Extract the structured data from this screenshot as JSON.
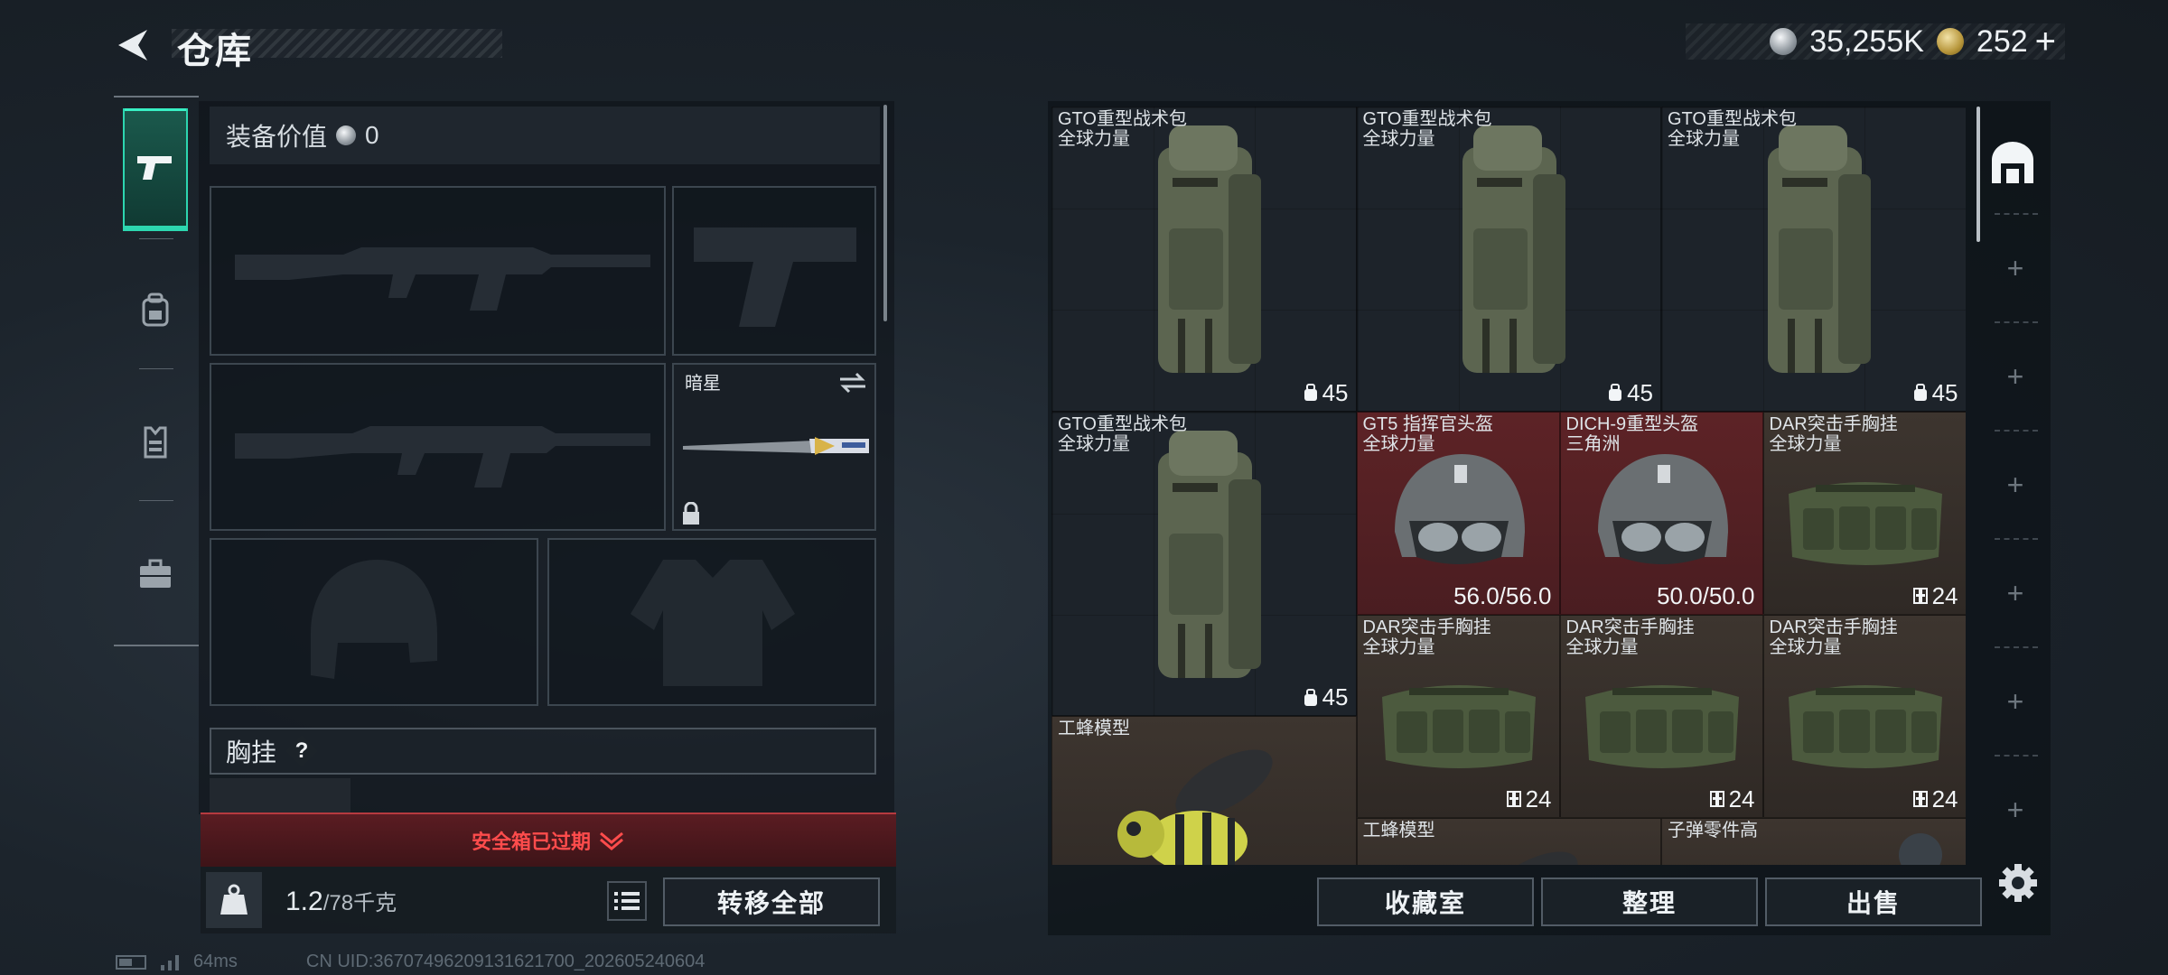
{
  "header": {
    "title": "仓库"
  },
  "currency": {
    "silver": "35,255K",
    "gold": "252",
    "plus": "+"
  },
  "left_tabs": [
    {
      "icon": "pistol-icon"
    },
    {
      "icon": "backpack-icon"
    },
    {
      "icon": "vest-icon"
    },
    {
      "icon": "briefcase-icon"
    }
  ],
  "equipment": {
    "value_label": "装备价值",
    "value": "0",
    "knife_name": "暗星",
    "chest_label": "胸挂",
    "chest_help": "?"
  },
  "safebox": {
    "text": "安全箱已过期"
  },
  "capacity": {
    "current": "1.2",
    "max": "/78千克"
  },
  "buttons": {
    "transfer_all": "转移全部",
    "collection": "收藏室",
    "sort": "整理",
    "sell": "出售"
  },
  "status": {
    "ping": "64ms",
    "uid": "CN UID:3670749620913162170​0_202605240604"
  },
  "inventory": [
    {
      "name": "GTO重型战术包",
      "sub": "全球力量",
      "value": "45",
      "type": "backpack"
    },
    {
      "name": "GTO重型战术包",
      "sub": "全球力量",
      "value": "45",
      "type": "backpack"
    },
    {
      "name": "GTO重型战术包",
      "sub": "全球力量",
      "value": "45",
      "type": "backpack"
    },
    {
      "name": "GTO重型战术包",
      "sub": "全球力量",
      "value": "45",
      "type": "backpack"
    },
    {
      "name": "GT5 指挥官头盔",
      "sub": "全球力量",
      "value": "56.0/56.0",
      "type": "helmet"
    },
    {
      "name": "DICH-9重型头盔",
      "sub": "三角洲",
      "value": "50.0/50.0",
      "type": "helmet"
    },
    {
      "name": "DAR突击手胸挂",
      "sub": "全球力量",
      "value": "24",
      "type": "rig"
    },
    {
      "name": "DAR突击手胸挂",
      "sub": "全球力量",
      "value": "24",
      "type": "rig"
    },
    {
      "name": "DAR突击手胸挂",
      "sub": "全球力量",
      "value": "24",
      "type": "rig"
    },
    {
      "name": "DAR突击手胸挂",
      "sub": "全球力量",
      "value": "24",
      "type": "rig"
    },
    {
      "name": "工蜂模型",
      "sub": "",
      "value": "",
      "type": "bee"
    },
    {
      "name": "工蜂模型",
      "sub": "",
      "value": "",
      "type": "bee"
    },
    {
      "name": "子弹零件高",
      "sub": "",
      "value": "",
      "type": "misc"
    }
  ]
}
